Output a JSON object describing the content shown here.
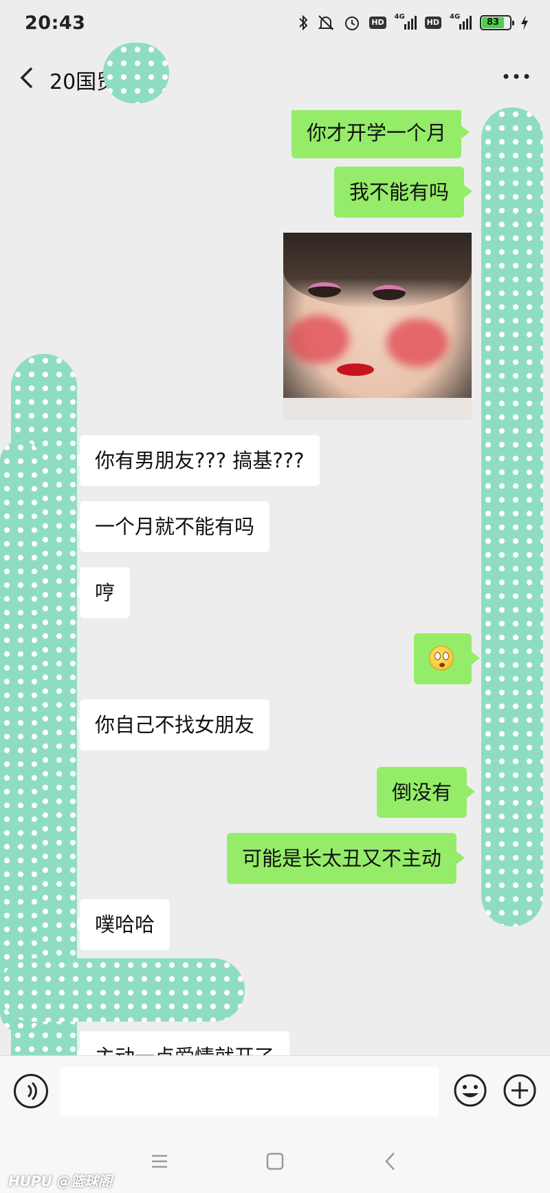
{
  "status_bar": {
    "time": "20:43",
    "battery": "83",
    "network_1": "4G",
    "network_2": "4G",
    "hd_1": "HD",
    "hd_2": "HD"
  },
  "header": {
    "title": "20国贸",
    "back_icon": "chevron-left-icon",
    "more_icon": "more-dots-icon"
  },
  "messages": [
    {
      "side": "out",
      "type": "text",
      "text": "你才开学一个月"
    },
    {
      "side": "out",
      "type": "text",
      "text": "我不能有吗"
    },
    {
      "side": "out",
      "type": "sticker",
      "text": ""
    },
    {
      "side": "in",
      "type": "text",
      "text": "你有男朋友??? 搞基???"
    },
    {
      "side": "in",
      "type": "text",
      "text": "一个月就不能有吗"
    },
    {
      "side": "in",
      "type": "text",
      "text": "哼"
    },
    {
      "side": "out",
      "type": "emoji",
      "text": ""
    },
    {
      "side": "in",
      "type": "text",
      "text": "你自己不找女朋友"
    },
    {
      "side": "out",
      "type": "text",
      "text": "倒没有"
    },
    {
      "side": "out",
      "type": "text",
      "text": "可能是长太丑又不主动"
    },
    {
      "side": "in",
      "type": "text",
      "text": "噗哈哈"
    },
    {
      "side": "in",
      "type": "text",
      "text": "主动一点爱情就开了"
    }
  ],
  "input_bar": {
    "value": "",
    "voice_icon": "voice-icon",
    "emoji_icon": "emoji-icon",
    "plus_icon": "plus-icon"
  },
  "system_nav": {
    "menu_icon": "menu-icon",
    "home_icon": "home-square-icon",
    "back_icon": "back-triangle-icon"
  },
  "watermark": "HUPU @篮球阁",
  "colors": {
    "background": "#ededed",
    "outgoing_bubble": "#95ec69",
    "incoming_bubble": "#ffffff",
    "mask": "#8fdcc4"
  }
}
